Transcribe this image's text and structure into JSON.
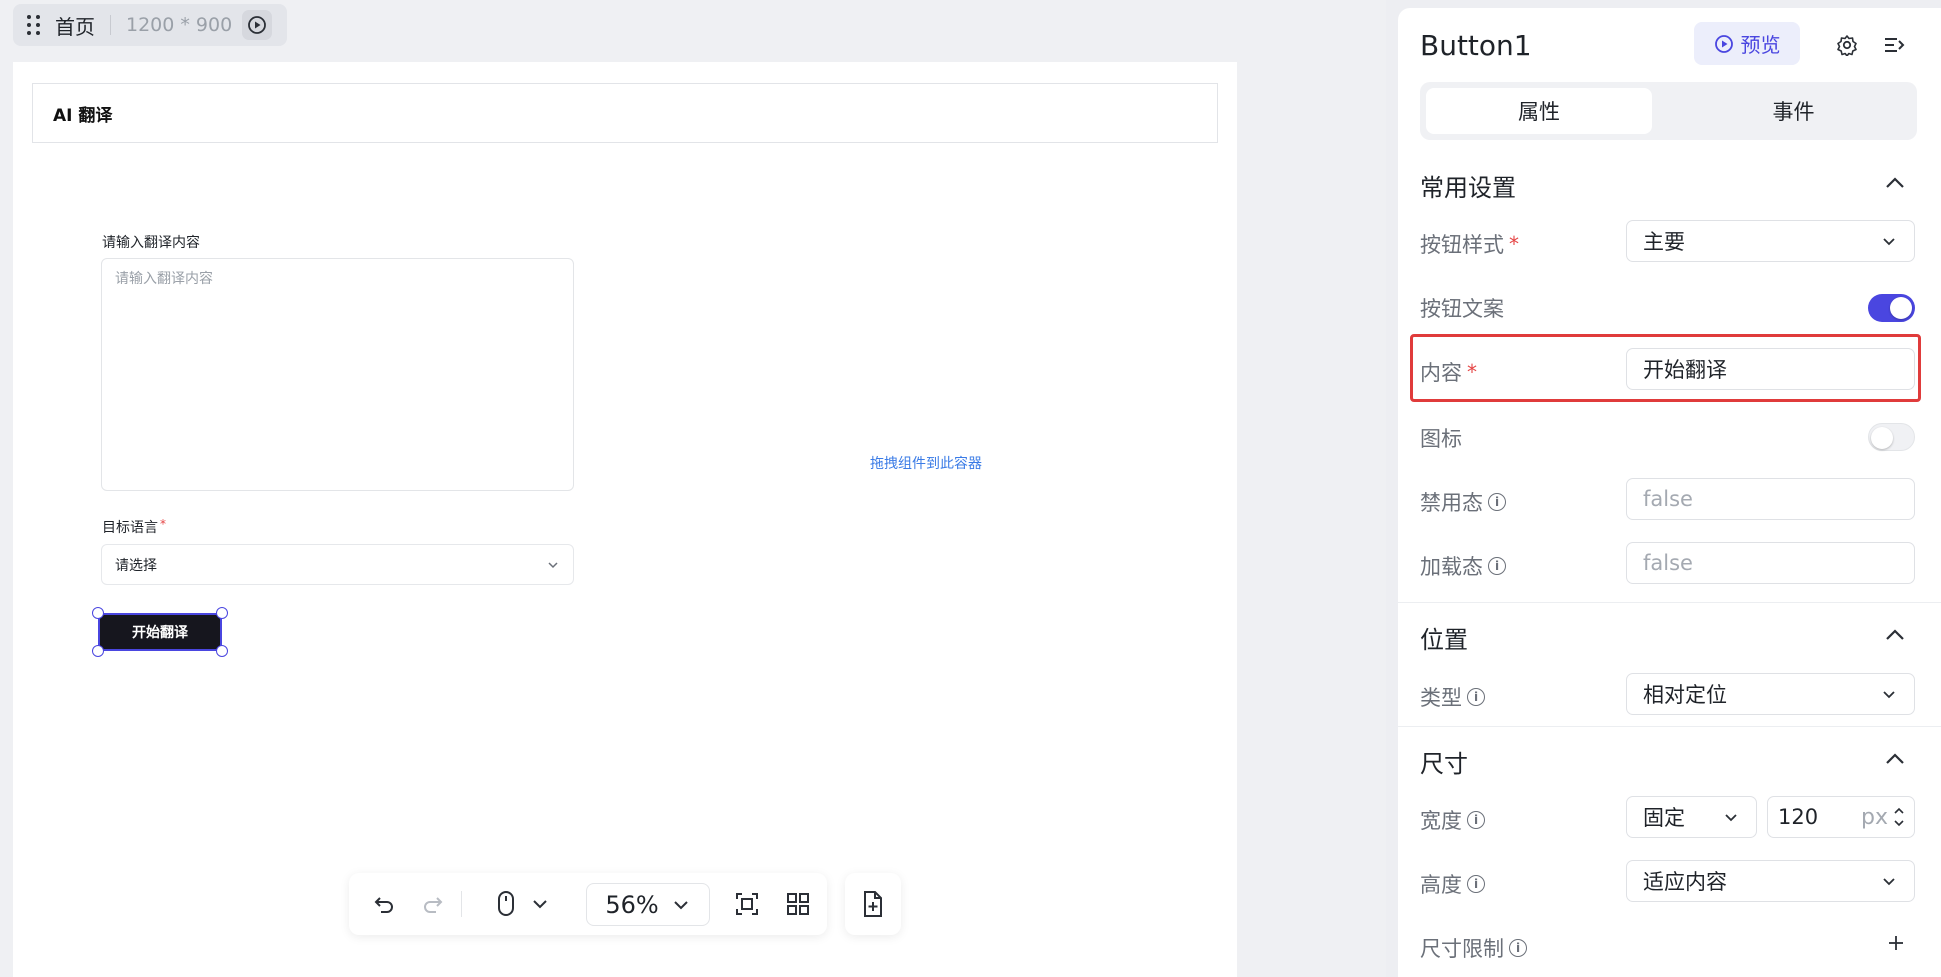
{
  "topbar": {
    "page_name": "首页",
    "page_size": "1200 * 900"
  },
  "artboard": {
    "app_title": "AI 翻译",
    "input_label": "请输入翻译内容",
    "textarea_placeholder": "请输入翻译内容",
    "language_label": "目标语言",
    "language_required": "*",
    "language_value": "请选择",
    "start_button": "开始翻译",
    "drop_hint": "拖拽组件到此容器"
  },
  "toolbar": {
    "zoom": "56%"
  },
  "panel": {
    "component_name": "Button1",
    "preview_label": "预览",
    "tabs": [
      "属性",
      "事件"
    ],
    "sections": {
      "common": "常用设置",
      "position": "位置",
      "size": "尺寸"
    },
    "rows": {
      "button_style": {
        "label": "按钮样式",
        "required": "*",
        "value": "主要"
      },
      "button_text": {
        "label": "按钮文案",
        "toggle": true
      },
      "content": {
        "label": "内容",
        "required": "*",
        "value": "开始翻译"
      },
      "icon": {
        "label": "图标",
        "toggle": false
      },
      "disabled": {
        "label": "禁用态",
        "value": "false"
      },
      "loading": {
        "label": "加载态",
        "value": "false"
      },
      "type": {
        "label": "类型",
        "value": "相对定位"
      },
      "width": {
        "label": "宽度",
        "mode": "固定",
        "value": "120",
        "unit": "px"
      },
      "height": {
        "label": "高度",
        "value": "适应内容"
      },
      "size_limit": {
        "label": "尺寸限制"
      }
    }
  },
  "colors": {
    "accent": "#4a46e0",
    "highlight": "#e03b3b",
    "button_bg": "#16161e",
    "link": "#3a7be6"
  }
}
